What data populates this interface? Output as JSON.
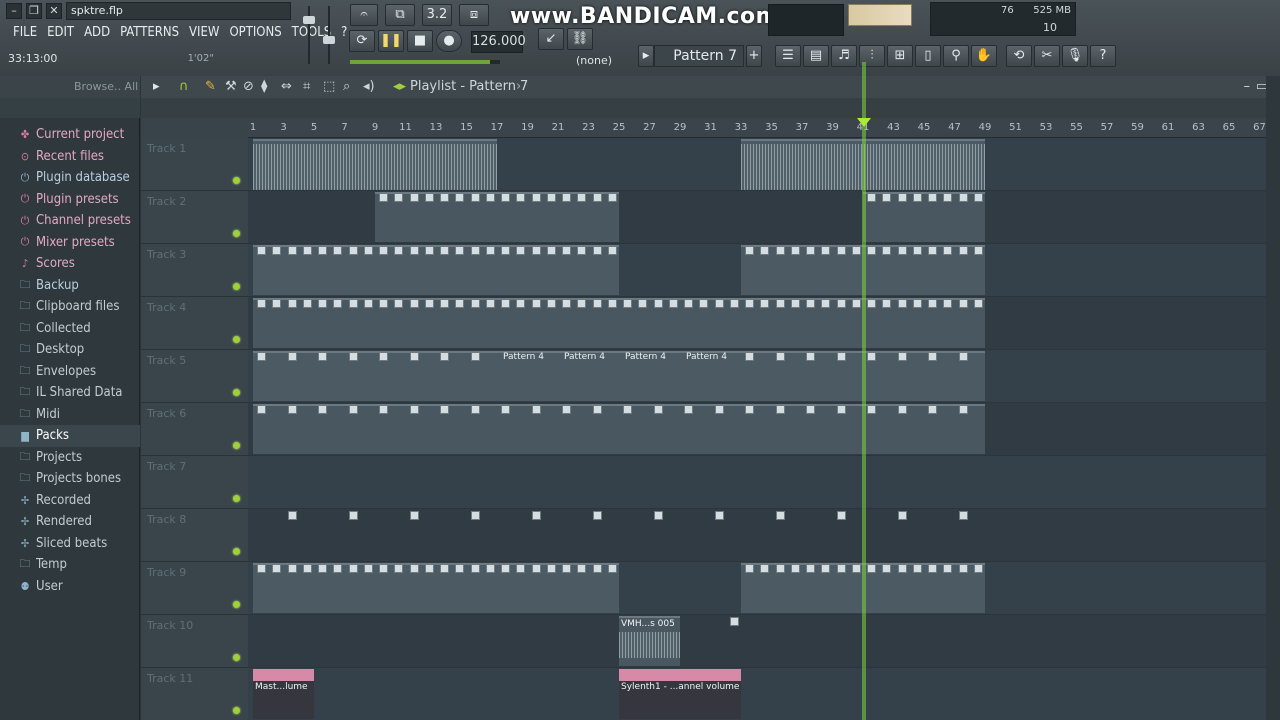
{
  "window": {
    "project_file": "spktre.flp"
  },
  "menu": [
    "FILE",
    "EDIT",
    "ADD",
    "PATTERNS",
    "VIEW",
    "OPTIONS",
    "TOOLS",
    "?"
  ],
  "transport": {
    "time": "33:13:00",
    "length_hint": "1'02\"",
    "tempo": "126.000",
    "snap": "(none)",
    "pattern_selector": "Pattern 7"
  },
  "overlay": {
    "watermark": "www.BANDICAM.com"
  },
  "meters": {
    "cpu_value": "76",
    "memory": "525 MB",
    "polyphony": "10"
  },
  "browser": {
    "header": "Browse.. All",
    "items": [
      {
        "label": "Current project",
        "icon": "hierarchy-icon",
        "style": "pink"
      },
      {
        "label": "Recent files",
        "icon": "clock-icon",
        "style": "pink"
      },
      {
        "label": "Plugin database",
        "icon": "plug-icon",
        "style": "blue"
      },
      {
        "label": "Plugin presets",
        "icon": "plug-icon",
        "style": "pink"
      },
      {
        "label": "Channel presets",
        "icon": "plug-icon",
        "style": "pink"
      },
      {
        "label": "Mixer presets",
        "icon": "plug-icon",
        "style": "pink"
      },
      {
        "label": "Scores",
        "icon": "note-icon",
        "style": "pink"
      },
      {
        "label": "Backup",
        "icon": "folder-icon",
        "style": "blue"
      },
      {
        "label": "Clipboard files",
        "icon": "folder-icon",
        "style": ""
      },
      {
        "label": "Collected",
        "icon": "folder-icon",
        "style": ""
      },
      {
        "label": "Desktop",
        "icon": "folder-icon",
        "style": ""
      },
      {
        "label": "Envelopes",
        "icon": "folder-icon",
        "style": ""
      },
      {
        "label": "IL Shared Data",
        "icon": "folder-icon",
        "style": ""
      },
      {
        "label": "Midi",
        "icon": "folder-icon",
        "style": ""
      },
      {
        "label": "Packs",
        "icon": "packs-icon",
        "style": "sel"
      },
      {
        "label": "Projects",
        "icon": "folder-icon",
        "style": ""
      },
      {
        "label": "Projects bones",
        "icon": "folder-icon",
        "style": ""
      },
      {
        "label": "Recorded",
        "icon": "plus-icon",
        "style": ""
      },
      {
        "label": "Rendered",
        "icon": "plus-icon",
        "style": ""
      },
      {
        "label": "Sliced beats",
        "icon": "plus-icon",
        "style": ""
      },
      {
        "label": "Temp",
        "icon": "folder-icon",
        "style": ""
      },
      {
        "label": "User",
        "icon": "user-icon",
        "style": ""
      }
    ]
  },
  "playlist": {
    "title": "Playlist - Pattern 7",
    "ruler": [
      "1",
      "3",
      "5",
      "7",
      "9",
      "11",
      "13",
      "15",
      "17",
      "19",
      "21",
      "23",
      "25",
      "27",
      "29",
      "31",
      "33",
      "35",
      "37",
      "39",
      "41",
      "43",
      "45",
      "47",
      "49",
      "51",
      "53",
      "55",
      "57",
      "59",
      "61",
      "63",
      "65",
      "67"
    ],
    "tracks": [
      "Track 1",
      "Track 2",
      "Track 3",
      "Track 4",
      "Track 5",
      "Track 6",
      "Track 7",
      "Track 8",
      "Track 9",
      "Track 10",
      "Track 11"
    ],
    "clip_labels": {
      "pattern4": "Pattern 4",
      "audio": "VMH...s 005",
      "auto1": "Mast...lume",
      "auto2": "Sylenth1 - ...annel volume"
    }
  }
}
